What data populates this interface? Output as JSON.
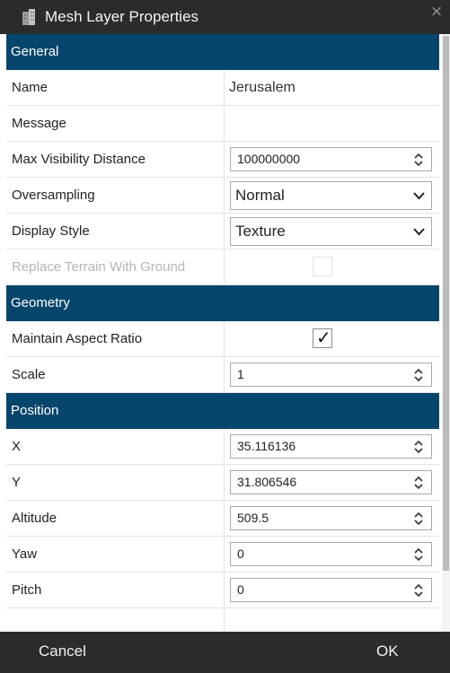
{
  "window": {
    "title": "Mesh Layer Properties",
    "close_glyph": "×",
    "icon": "building-icon"
  },
  "sections": {
    "general": "General",
    "geometry": "Geometry",
    "position": "Position"
  },
  "general": {
    "name": {
      "label": "Name",
      "value": "Jerusalem"
    },
    "message": {
      "label": "Message",
      "value": ""
    },
    "max_visibility": {
      "label": "Max Visibility Distance",
      "value": "100000000"
    },
    "oversampling": {
      "label": "Oversampling",
      "value": "Normal"
    },
    "display_style": {
      "label": "Display Style",
      "value": "Texture"
    },
    "replace_terrain": {
      "label": "Replace Terrain With Ground",
      "checked": false,
      "disabled": true
    }
  },
  "geometry": {
    "maintain_aspect": {
      "label": "Maintain Aspect Ratio",
      "checked": true,
      "mark": "✓"
    },
    "scale": {
      "label": "Scale",
      "value": "1"
    }
  },
  "position": {
    "x": {
      "label": "X",
      "value": "35.116136"
    },
    "y": {
      "label": "Y",
      "value": "31.806546"
    },
    "altitude": {
      "label": "Altitude",
      "value": "509.5"
    },
    "yaw": {
      "label": "Yaw",
      "value": "0"
    },
    "pitch": {
      "label": "Pitch",
      "value": "0"
    }
  },
  "footer": {
    "cancel": "Cancel",
    "ok": "OK"
  },
  "colors": {
    "section_header": "#07466c",
    "titlebar": "#2b2b2b",
    "content_bg": "#ffffff"
  }
}
